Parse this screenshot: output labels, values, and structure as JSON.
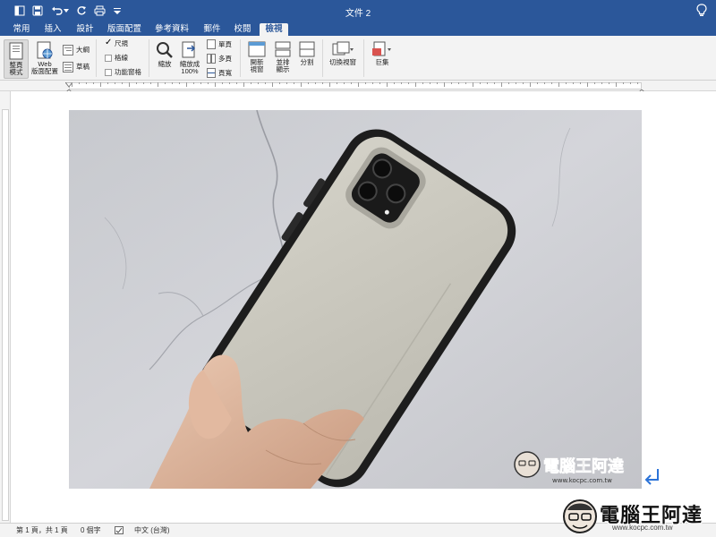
{
  "window": {
    "title": "文件 2"
  },
  "quick_access": {
    "icons": [
      "sidebar-icon",
      "save-icon",
      "undo-icon",
      "redo-icon",
      "print-icon",
      "customize-icon"
    ]
  },
  "tabs": [
    {
      "label": "常用",
      "active": false
    },
    {
      "label": "插入",
      "active": false
    },
    {
      "label": "設計",
      "active": false
    },
    {
      "label": "版面配置",
      "active": false
    },
    {
      "label": "參考資料",
      "active": false
    },
    {
      "label": "郵件",
      "active": false
    },
    {
      "label": "校閱",
      "active": false
    },
    {
      "label": "檢視",
      "active": true
    }
  ],
  "ribbon": {
    "views": {
      "print_layout": "整頁\n模式",
      "web_layout": "Web\n版面配置",
      "outline": "大綱",
      "draft": "草稿"
    },
    "show": {
      "ruler": {
        "label": "尺規",
        "checked": true
      },
      "gridlines": {
        "label": "格線",
        "checked": false
      },
      "nav_pane": {
        "label": "功能窗格",
        "checked": false
      }
    },
    "zoom": {
      "zoom": "縮放",
      "zoom_100": "縮放成\n100%",
      "one_page": "單頁",
      "multi_page": "多頁",
      "page_width": "頁寬"
    },
    "window": {
      "new_window": "開新\n視窗",
      "arrange": "並排\n顯示",
      "split": "分割",
      "switch": "切換視窗"
    },
    "macros": "巨集"
  },
  "statusbar": {
    "page": "第 1 頁，共 1 頁",
    "words": "0 個字",
    "language": "中文 (台灣)"
  },
  "watermark": {
    "text": "電腦王阿達",
    "url": "www.kocpc.com.tw"
  },
  "colors": {
    "accent": "#2b579a",
    "ribbon_bg": "#f3f3f3",
    "wall": "#cfd1d6",
    "case": "#c9c7bd",
    "bumper": "#1d1d1d"
  }
}
